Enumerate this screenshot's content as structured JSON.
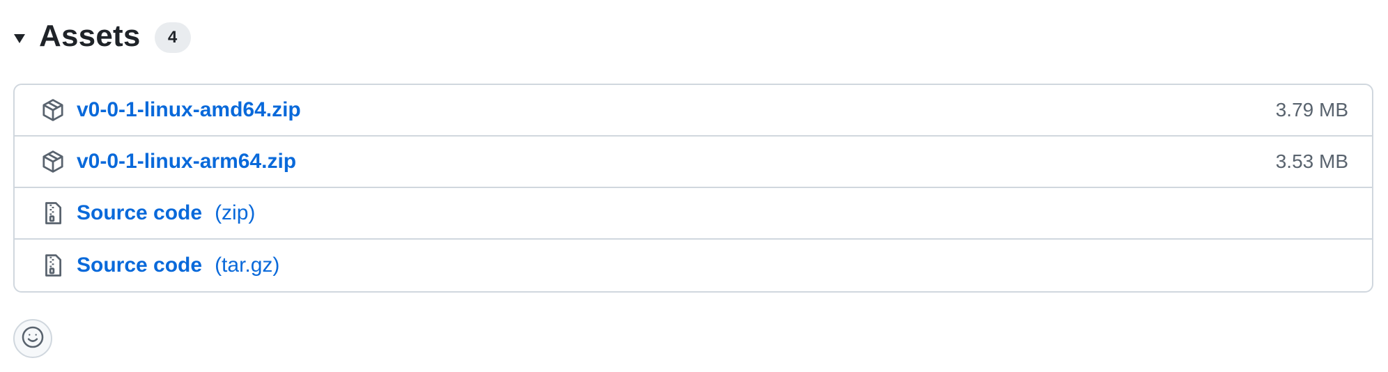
{
  "assets": {
    "title": "Assets",
    "count": "4",
    "items": [
      {
        "name": "v0-0-1-linux-amd64.zip",
        "suffix": "",
        "size": "3.79 MB",
        "icon": "package-icon"
      },
      {
        "name": "v0-0-1-linux-arm64.zip",
        "suffix": "",
        "size": "3.53 MB",
        "icon": "package-icon"
      },
      {
        "name": "Source code",
        "suffix": "(zip)",
        "size": "",
        "icon": "file-zip-icon"
      },
      {
        "name": "Source code",
        "suffix": "(tar.gz)",
        "size": "",
        "icon": "file-zip-icon"
      }
    ]
  },
  "reaction": {
    "icon": "smiley-icon"
  },
  "colors": {
    "link": "#0969da",
    "border": "#d0d7de",
    "muted": "#59636e",
    "text": "#1f2328"
  }
}
